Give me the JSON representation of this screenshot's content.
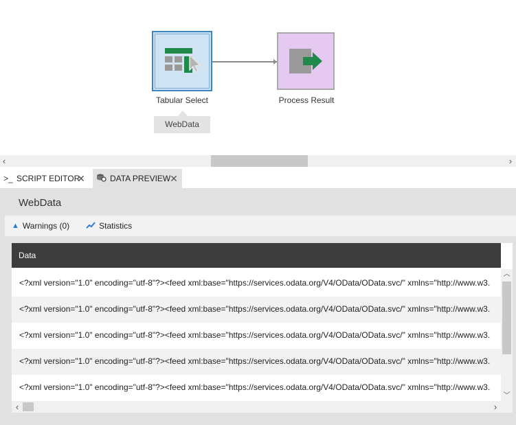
{
  "canvas": {
    "nodes": [
      {
        "label": "Tabular Select",
        "icon": "table-select-icon",
        "color": "#cfe3f2"
      },
      {
        "label": "Process Result",
        "icon": "export-arrow-icon",
        "color": "#e5c9f1"
      }
    ],
    "tag": "WebData"
  },
  "tabs": [
    {
      "label": "SCRIPT EDITOR",
      "icon": "terminal-icon"
    },
    {
      "label": "DATA PREVIEW",
      "icon": "data-preview-icon"
    }
  ],
  "panel": {
    "title": "WebData",
    "toolbar": {
      "warnings_label": "Warnings (0)",
      "statistics_label": "Statistics"
    },
    "grid": {
      "columns": [
        "Data"
      ],
      "rows": [
        "<?xml version=\"1.0\" encoding=\"utf-8\"?><feed xml:base=\"https://services.odata.org/V4/OData/OData.svc/\" xmlns=\"http://www.w3.",
        "<?xml version=\"1.0\" encoding=\"utf-8\"?><feed xml:base=\"https://services.odata.org/V4/OData/OData.svc/\" xmlns=\"http://www.w3.",
        "<?xml version=\"1.0\" encoding=\"utf-8\"?><feed xml:base=\"https://services.odata.org/V4/OData/OData.svc/\" xmlns=\"http://www.w3.",
        "<?xml version=\"1.0\" encoding=\"utf-8\"?><feed xml:base=\"https://services.odata.org/V4/OData/OData.svc/\" xmlns=\"http://www.w3.",
        "<?xml version=\"1.0\" encoding=\"utf-8\"?><feed xml:base=\"https://services.odata.org/V4/OData/OData.svc/\" xmlns=\"http://www.w3."
      ]
    }
  }
}
